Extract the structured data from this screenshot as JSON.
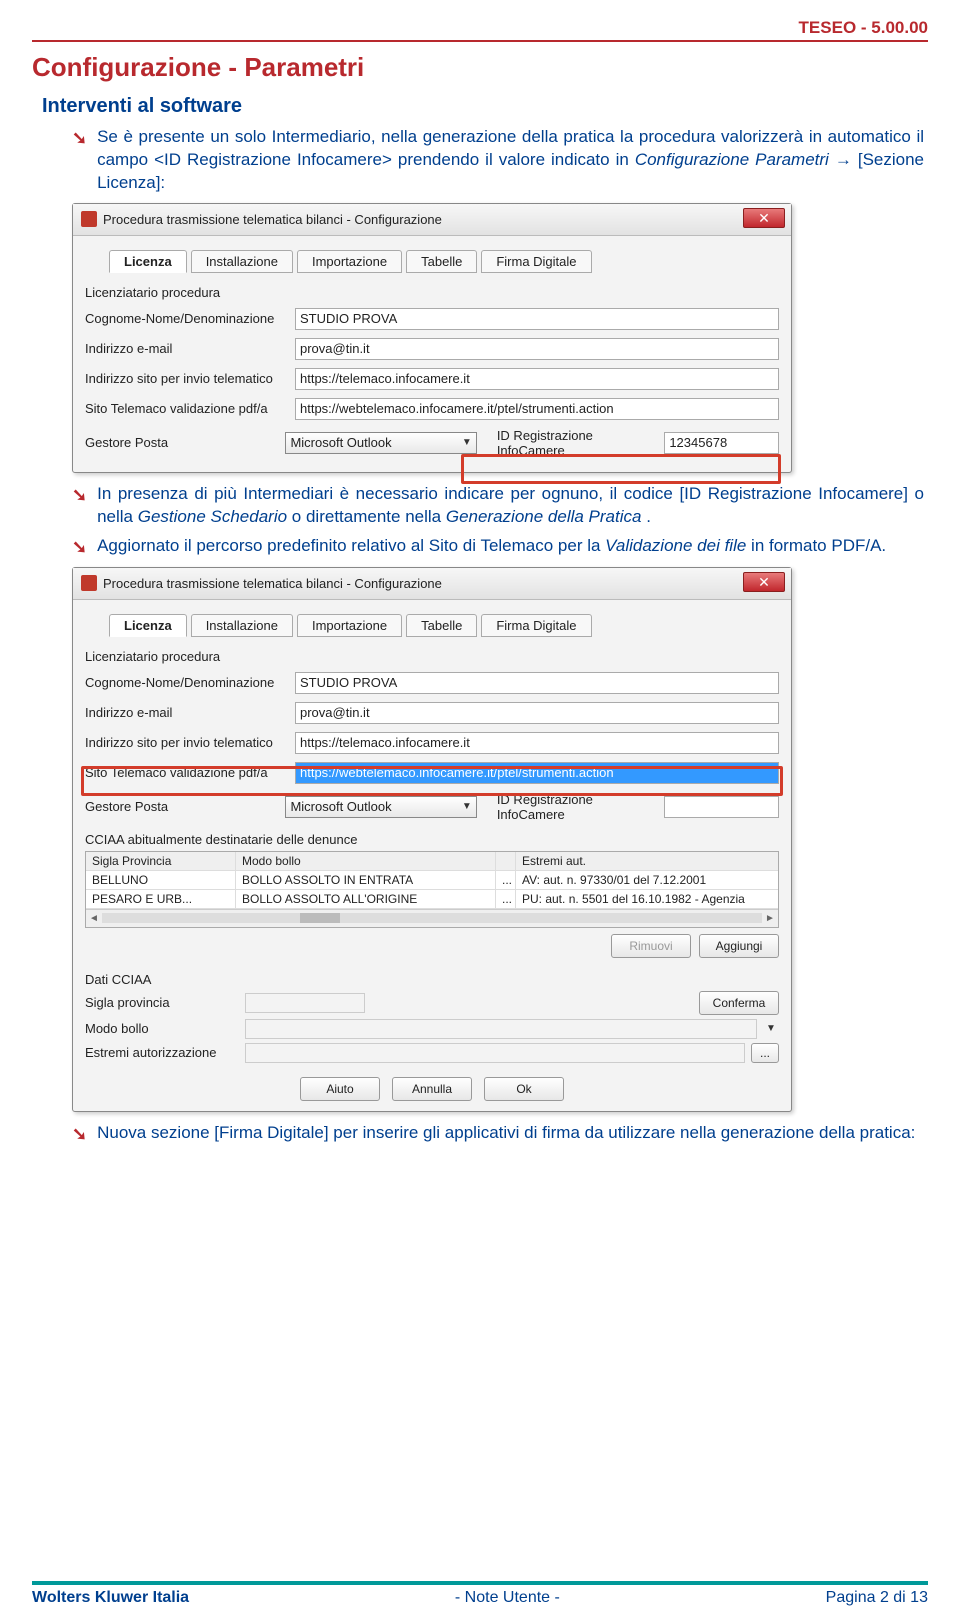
{
  "header": {
    "right_text": "TESEO - 5.00.00"
  },
  "section": {
    "title": "Configurazione - Parametri",
    "subtitle": "Interventi al software"
  },
  "bullets": {
    "b1_pre": "Se è presente un solo Intermediario, nella generazione della pratica la procedura valorizzerà in automatico il campo <ID Registrazione Infocamere> prendendo il valore indicato in ",
    "b1_italic1": "Configurazione Parametri",
    "b1_arrow": " → ",
    "b1_post": "[Sezione Licenza]:",
    "b2": "In presenza di più Intermediari è necessario indicare per ognuno, il codice [ID Registrazione Infocamere] o nella ",
    "b2_it1": "Gestione Schedario",
    "b2_mid": " o direttamente nella ",
    "b2_it2": "Generazione della Pratica",
    "b2_end": ".",
    "b3_pre": "Aggiornato il percorso predefinito relativo al Sito di Telemaco per la ",
    "b3_it": "Validazione dei file",
    "b3_post": " in formato PDF/A.",
    "b4": "Nuova sezione [Firma Digitale] per inserire gli applicativi di firma da utilizzare nella generazione della pratica:"
  },
  "dialog": {
    "title": "Procedura trasmissione telematica bilanci - Configurazione",
    "tabs": [
      "Licenza",
      "Installazione",
      "Importazione",
      "Tabelle",
      "Firma Digitale"
    ],
    "labels": {
      "licenziatario": "Licenziatario procedura",
      "denominazione": "Cognome-Nome/Denominazione",
      "email": "Indirizzo e-mail",
      "sito_invio": "Indirizzo sito per invio telematico",
      "sito_val": "Sito Telemaco validazione pdf/a",
      "gestore": "Gestore Posta",
      "idreg": "ID Registrazione InfoCamere",
      "cciaa_section": "CCIAA abitualmente destinatarie delle denunce",
      "dati_cciaa": "Dati CCIAA",
      "sigla_prov": "Sigla provincia",
      "modo_bollo": "Modo bollo",
      "estremi_aut": "Estremi autorizzazione"
    },
    "values": {
      "denominazione": "STUDIO PROVA",
      "email": "prova@tin.it",
      "sito_invio": "https://telemaco.infocamere.it",
      "sito_val": "https://webtelemaco.infocamere.it/ptel/strumenti.action",
      "gestore": "Microsoft Outlook",
      "idreg": "12345678"
    },
    "table": {
      "headers": [
        "Sigla Provincia",
        "Modo bollo",
        "",
        "Estremi aut."
      ],
      "rows": [
        [
          "BELLUNO",
          "BOLLO ASSOLTO IN ENTRATA",
          "...",
          "AV: aut. n. 97330/01 del 7.12.2001"
        ],
        [
          "PESARO E URB...",
          "BOLLO ASSOLTO ALL'ORIGINE",
          "...",
          "PU: aut. n. 5501 del 16.10.1982 - Agenzia"
        ]
      ]
    },
    "buttons": {
      "rimuovi": "Rimuovi",
      "aggiungi": "Aggiungi",
      "conferma": "Conferma",
      "aiuto": "Aiuto",
      "annulla": "Annulla",
      "ok": "Ok"
    }
  },
  "footer": {
    "left": "Wolters Kluwer Italia",
    "center": "-  Note Utente  -",
    "right": "Pagina  2 di 13"
  }
}
